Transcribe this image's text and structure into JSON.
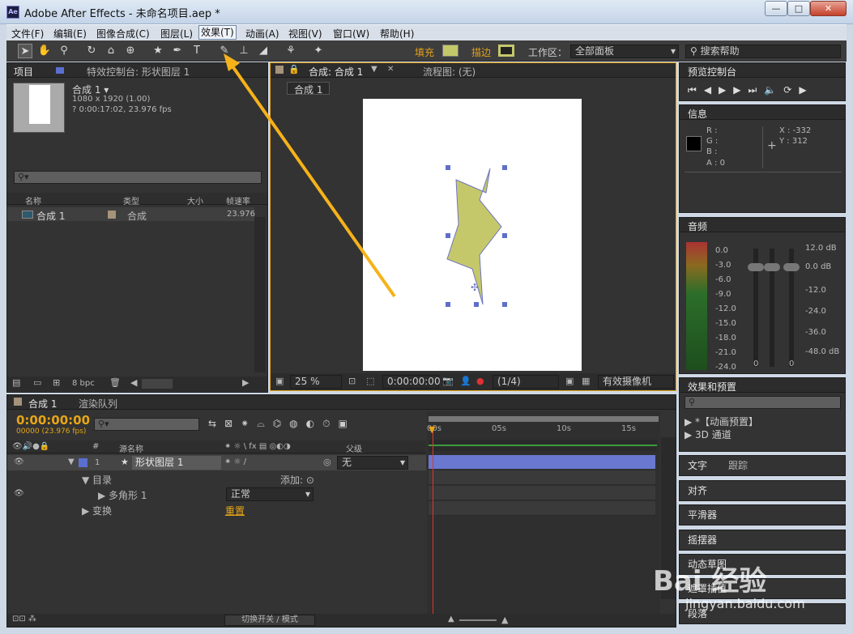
{
  "window": {
    "title": "Adobe After Effects - 未命名项目.aep *",
    "app_icon": "Ae",
    "minimize": "—",
    "maximize": "□",
    "close": "✕"
  },
  "menu": [
    "文件(F)",
    "编辑(E)",
    "图像合成(C)",
    "图层(L)",
    "效果(T)",
    "动画(A)",
    "视图(V)",
    "窗口(W)",
    "帮助(H)"
  ],
  "toolbar": {
    "fill_label": "填充",
    "stroke_label": "描边",
    "workspace_label": "工作区：",
    "workspace_value": "全部面板",
    "search_placeholder": "搜索帮助",
    "fill_color": "#c5c86a",
    "stroke_color": "#c5c86a"
  },
  "project": {
    "tab": "项目",
    "effects_tab": "特效控制台: 形状图层 1",
    "comp_name": "合成 1 ▾",
    "comp_res": "1080 x 1920 (1.00)",
    "comp_dur": "? 0:00:17:02, 23.976 fps",
    "cols": {
      "name": "名称",
      "type": "类型",
      "size": "大小",
      "rate": "帧速率"
    },
    "row": {
      "name": "合成 1",
      "type": "合成",
      "rate": "23.976"
    },
    "bpc": "8 bpc"
  },
  "viewer": {
    "tab": "合成: 合成 1",
    "flow_tab": "流程图: (无)",
    "comp_chip": "合成 1",
    "zoom": "25 %",
    "timecode": "0:00:00:00",
    "res": "(1/4)",
    "camera": "有效摄像机"
  },
  "preview": {
    "tab": "预览控制台"
  },
  "info": {
    "tab": "信息",
    "r": "R :",
    "g": "G :",
    "b": "B :",
    "a": "A : 0",
    "x": "X : -332",
    "y": "Y : 312"
  },
  "audio": {
    "tab": "音频",
    "left_labels": [
      "0.0",
      "-3.0",
      "-6.0",
      "-9.0",
      "-12.0",
      "-15.0",
      "-18.0",
      "-21.0",
      "-24.0"
    ],
    "right_labels": [
      "12.0 dB",
      "0.0 dB",
      "-12.0",
      "-24.0",
      "-36.0",
      "-48.0 dB"
    ],
    "zero_a": "0",
    "zero_b": "0"
  },
  "effects": {
    "tab": "效果和预置",
    "item1": "▶ *【动画预置】",
    "item2": "▶ 3D 通道"
  },
  "side_tabs": [
    "文字",
    "跟踪",
    "对齐",
    "平滑器",
    "摇摆器",
    "动态草图",
    "遮罩插值",
    "段落"
  ],
  "timeline": {
    "tab": "合成 1",
    "render_tab": "渲染队列",
    "time": "0:00:00:00",
    "frames": "00000 (23.976 fps)",
    "col_name": "源名称",
    "col_parent": "父级",
    "layer_num": "1",
    "layer_name": "形状图层 1",
    "parent_value": "无",
    "content": "目录",
    "add": "添加:",
    "polygon": "多角形 1",
    "mode": "正常",
    "transform": "变换",
    "reset": "重置",
    "switch_label": "切换开关 / 模式",
    "ruler": [
      "00s",
      "05s",
      "10s",
      "15s"
    ]
  },
  "watermark": {
    "text": "Bai 经验",
    "url": "jingyan.baidu.com"
  }
}
